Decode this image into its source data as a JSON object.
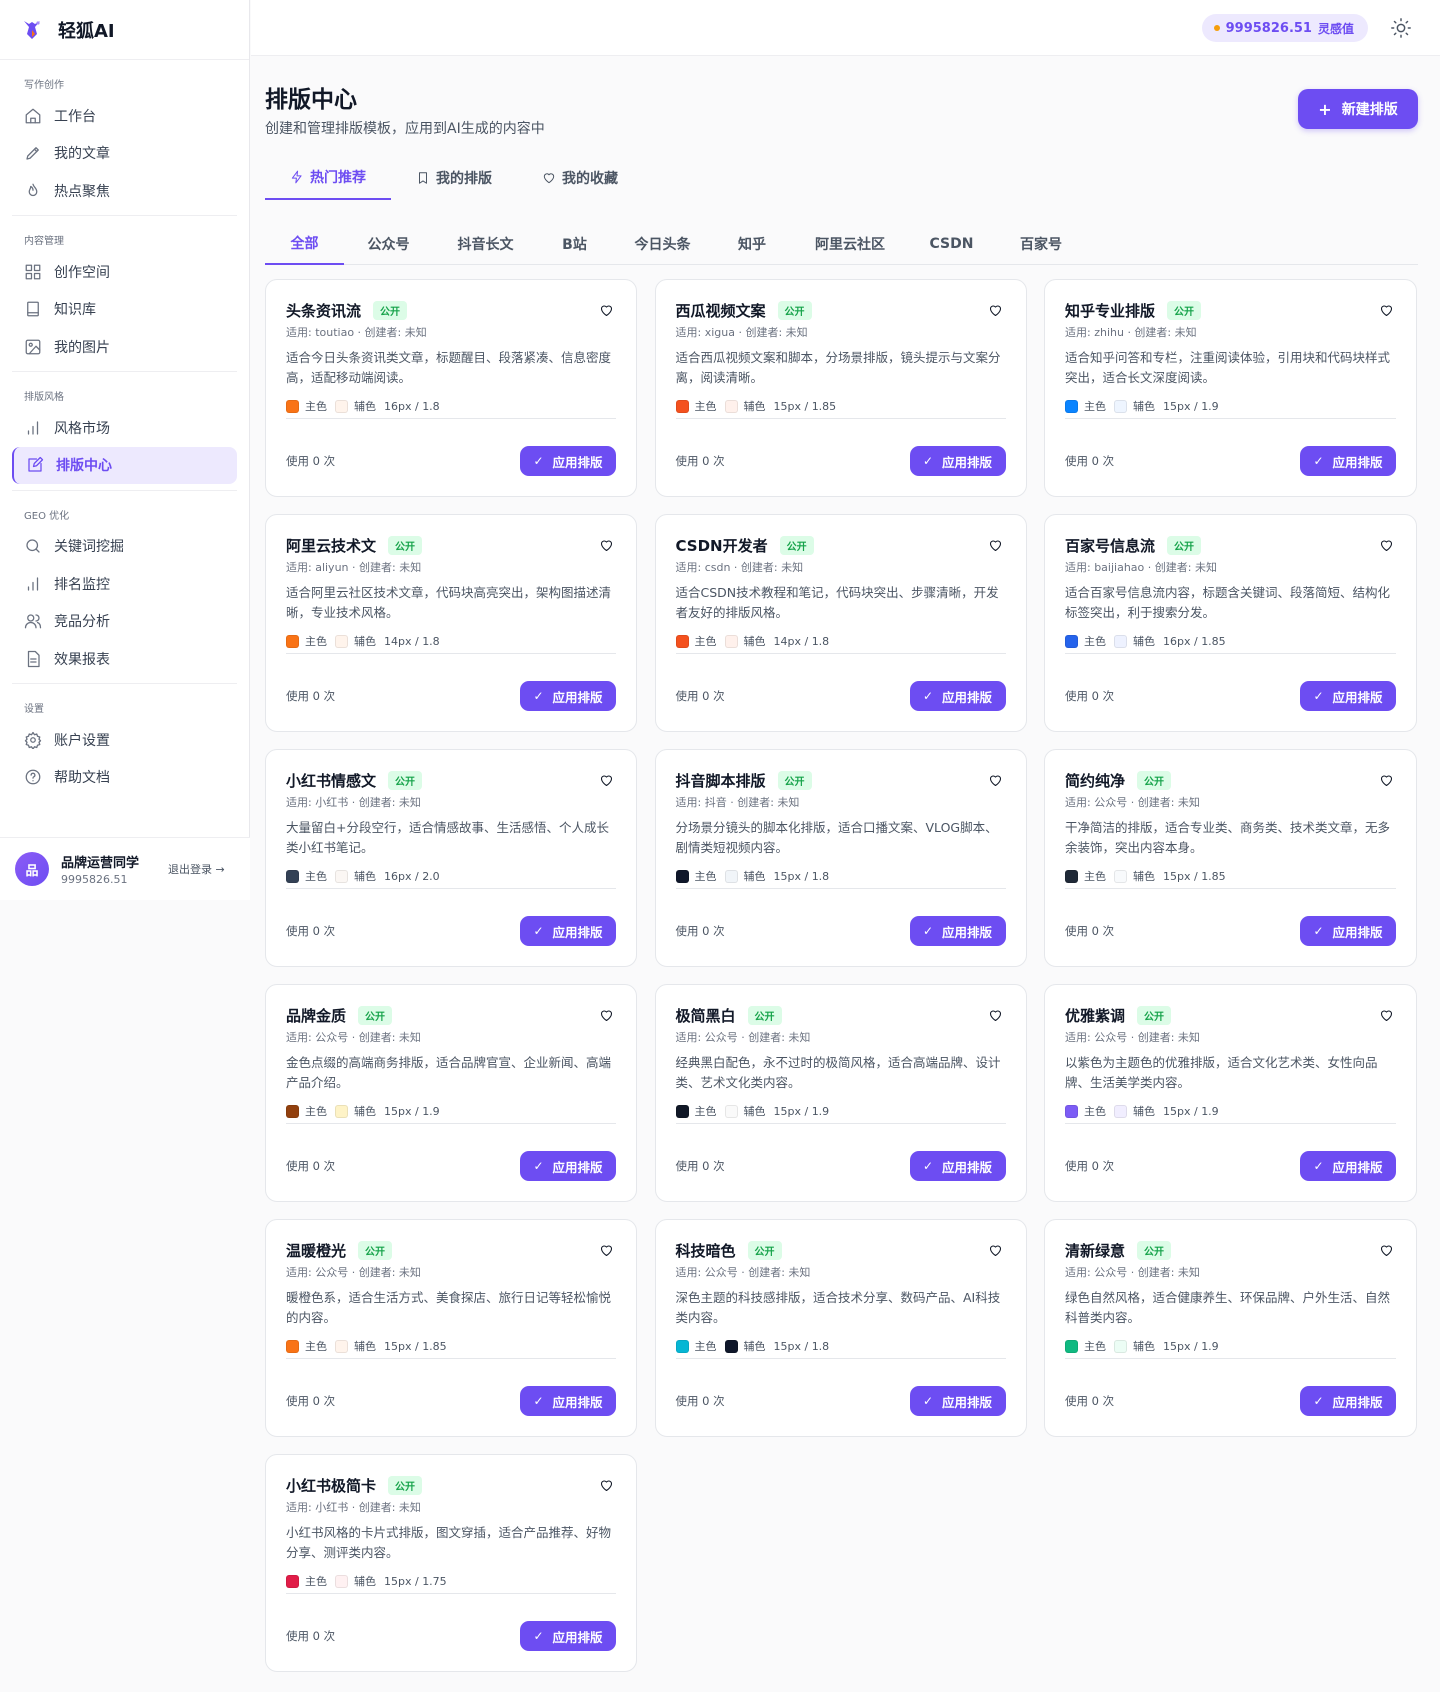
{
  "app": {
    "name": "轻狐AI"
  },
  "sidebar": {
    "groups": [
      {
        "title": "写作创作",
        "items": [
          {
            "label": "工作台",
            "icon": "home-icon"
          },
          {
            "label": "我的文章",
            "icon": "pen-icon"
          },
          {
            "label": "热点聚焦",
            "icon": "flame-icon"
          }
        ]
      },
      {
        "title": "内容管理",
        "items": [
          {
            "label": "创作空间",
            "icon": "grid-icon"
          },
          {
            "label": "知识库",
            "icon": "book-icon"
          },
          {
            "label": "我的图片",
            "icon": "image-icon"
          }
        ]
      },
      {
        "title": "排版风格",
        "items": [
          {
            "label": "风格市场",
            "icon": "bar-chart-icon"
          },
          {
            "label": "排版中心",
            "icon": "edit-square-icon",
            "active": true
          }
        ]
      },
      {
        "title": "GEO 优化",
        "items": [
          {
            "label": "关键词挖掘",
            "icon": "search-icon"
          },
          {
            "label": "排名监控",
            "icon": "bar-chart-icon"
          },
          {
            "label": "竞品分析",
            "icon": "users-icon"
          },
          {
            "label": "效果报表",
            "icon": "file-icon"
          }
        ]
      },
      {
        "title": "设置",
        "items": [
          {
            "label": "账户设置",
            "icon": "gear-icon"
          },
          {
            "label": "帮助文档",
            "icon": "help-icon"
          }
        ]
      }
    ],
    "user": {
      "avatar": "品",
      "name": "品牌运营同学",
      "id": "9995826.51",
      "logout": "退出登录 →"
    }
  },
  "header": {
    "credits": "9995826.51",
    "credits_unit": "灵感值"
  },
  "page": {
    "title": "排版中心",
    "subtitle": "创建和管理排版模板，应用到AI生成的内容中",
    "new_button": "新建排版"
  },
  "tabs": [
    {
      "label": "热门推荐",
      "icon": "bolt-icon",
      "active": true
    },
    {
      "label": "我的排版",
      "icon": "bookmark-icon"
    },
    {
      "label": "我的收藏",
      "icon": "heart-icon"
    }
  ],
  "platforms": [
    {
      "label": "全部",
      "active": true
    },
    {
      "label": "公众号"
    },
    {
      "label": "抖音长文"
    },
    {
      "label": "B站"
    },
    {
      "label": "今日头条"
    },
    {
      "label": "知乎"
    },
    {
      "label": "阿里云社区"
    },
    {
      "label": "CSDN"
    },
    {
      "label": "百家号"
    }
  ],
  "card_labels": {
    "badge": "公开",
    "primary": "主色",
    "secondary": "辅色",
    "usage": "使用 0 次",
    "apply": "应用排版"
  },
  "cards": [
    {
      "title": "头条资讯流",
      "meta": "适用: toutiao · 创建者: 未知",
      "desc": "适合今日头条资讯类文章，标题醒目、段落紧凑、信息密度高，适配移动端阅读。",
      "primary": "#f97316",
      "secondary": "#fff4ec",
      "font": "16px / 1.8"
    },
    {
      "title": "西瓜视频文案",
      "meta": "适用: xigua · 创建者: 未知",
      "desc": "适合西瓜视频文案和脚本，分场景排版，镜头提示与文案分离，阅读清晰。",
      "primary": "#f4511e",
      "secondary": "#fff1ec",
      "font": "15px / 1.85"
    },
    {
      "title": "知乎专业排版",
      "meta": "适用: zhihu · 创建者: 未知",
      "desc": "适合知乎问答和专栏，注重阅读体验，引用块和代码块样式突出，适合长文深度阅读。",
      "primary": "#0a84ff",
      "secondary": "#eef5ff",
      "font": "15px / 1.9"
    },
    {
      "title": "阿里云技术文",
      "meta": "适用: aliyun · 创建者: 未知",
      "desc": "适合阿里云社区技术文章，代码块高亮突出，架构图描述清晰，专业技术风格。",
      "primary": "#f97316",
      "secondary": "#fff4ec",
      "font": "14px / 1.8"
    },
    {
      "title": "CSDN开发者",
      "meta": "适用: csdn · 创建者: 未知",
      "desc": "适合CSDN技术教程和笔记，代码块突出、步骤清晰，开发者友好的排版风格。",
      "primary": "#f4511e",
      "secondary": "#fff1ec",
      "font": "14px / 1.8"
    },
    {
      "title": "百家号信息流",
      "meta": "适用: baijiahao · 创建者: 未知",
      "desc": "适合百家号信息流内容，标题含关键词、段落简短、结构化标签突出，利于搜索分发。",
      "primary": "#2563eb",
      "secondary": "#eef2ff",
      "font": "16px / 1.85"
    },
    {
      "title": "小红书情感文",
      "meta": "适用: 小红书 · 创建者: 未知",
      "desc": "大量留白+分段空行，适合情感故事、生活感悟、个人成长类小红书笔记。",
      "primary": "#334155",
      "secondary": "#fbf7f4",
      "font": "16px / 2.0"
    },
    {
      "title": "抖音脚本排版",
      "meta": "适用: 抖音 · 创建者: 未知",
      "desc": "分场景分镜头的脚本化排版，适合口播文案、VLOG脚本、剧情类短视频内容。",
      "primary": "#0f172a",
      "secondary": "#f1f5f9",
      "font": "15px / 1.8"
    },
    {
      "title": "简约纯净",
      "meta": "适用: 公众号 · 创建者: 未知",
      "desc": "干净简洁的排版，适合专业类、商务类、技术类文章，无多余装饰，突出内容本身。",
      "primary": "#1f2937",
      "secondary": "#f8fafc",
      "font": "15px / 1.85"
    },
    {
      "title": "品牌金质",
      "meta": "适用: 公众号 · 创建者: 未知",
      "desc": "金色点缀的高端商务排版，适合品牌官宣、企业新闻、高端产品介绍。",
      "primary": "#92400e",
      "secondary": "#fef3c7",
      "font": "15px / 1.9"
    },
    {
      "title": "极简黑白",
      "meta": "适用: 公众号 · 创建者: 未知",
      "desc": "经典黑白配色，永不过时的极简风格，适合高端品牌、设计类、艺术文化类内容。",
      "primary": "#111827",
      "secondary": "#fafafa",
      "font": "15px / 1.9"
    },
    {
      "title": "优雅紫调",
      "meta": "适用: 公众号 · 创建者: 未知",
      "desc": "以紫色为主题色的优雅排版，适合文化艺术类、女性向品牌、生活美学类内容。",
      "primary": "#7c5cf5",
      "secondary": "#f1eeff",
      "font": "15px / 1.9"
    },
    {
      "title": "温暖橙光",
      "meta": "适用: 公众号 · 创建者: 未知",
      "desc": "暖橙色系，适合生活方式、美食探店、旅行日记等轻松愉悦的内容。",
      "primary": "#f97316",
      "secondary": "#fff4ec",
      "font": "15px / 1.85"
    },
    {
      "title": "科技暗色",
      "meta": "适用: 公众号 · 创建者: 未知",
      "desc": "深色主题的科技感排版，适合技术分享、数码产品、AI科技类内容。",
      "primary": "#06b6d4",
      "secondary": "#0f172a",
      "font": "15px / 1.8"
    },
    {
      "title": "清新绿意",
      "meta": "适用: 公众号 · 创建者: 未知",
      "desc": "绿色自然风格，适合健康养生、环保品牌、户外生活、自然科普类内容。",
      "primary": "#10b981",
      "secondary": "#ecfdf5",
      "font": "15px / 1.9"
    },
    {
      "title": "小红书极简卡",
      "meta": "适用: 小红书 · 创建者: 未知",
      "desc": "小红书风格的卡片式排版，图文穿插，适合产品推荐、好物分享、测评类内容。",
      "primary": "#e11d48",
      "secondary": "#fff1f2",
      "font": "15px / 1.75"
    }
  ]
}
